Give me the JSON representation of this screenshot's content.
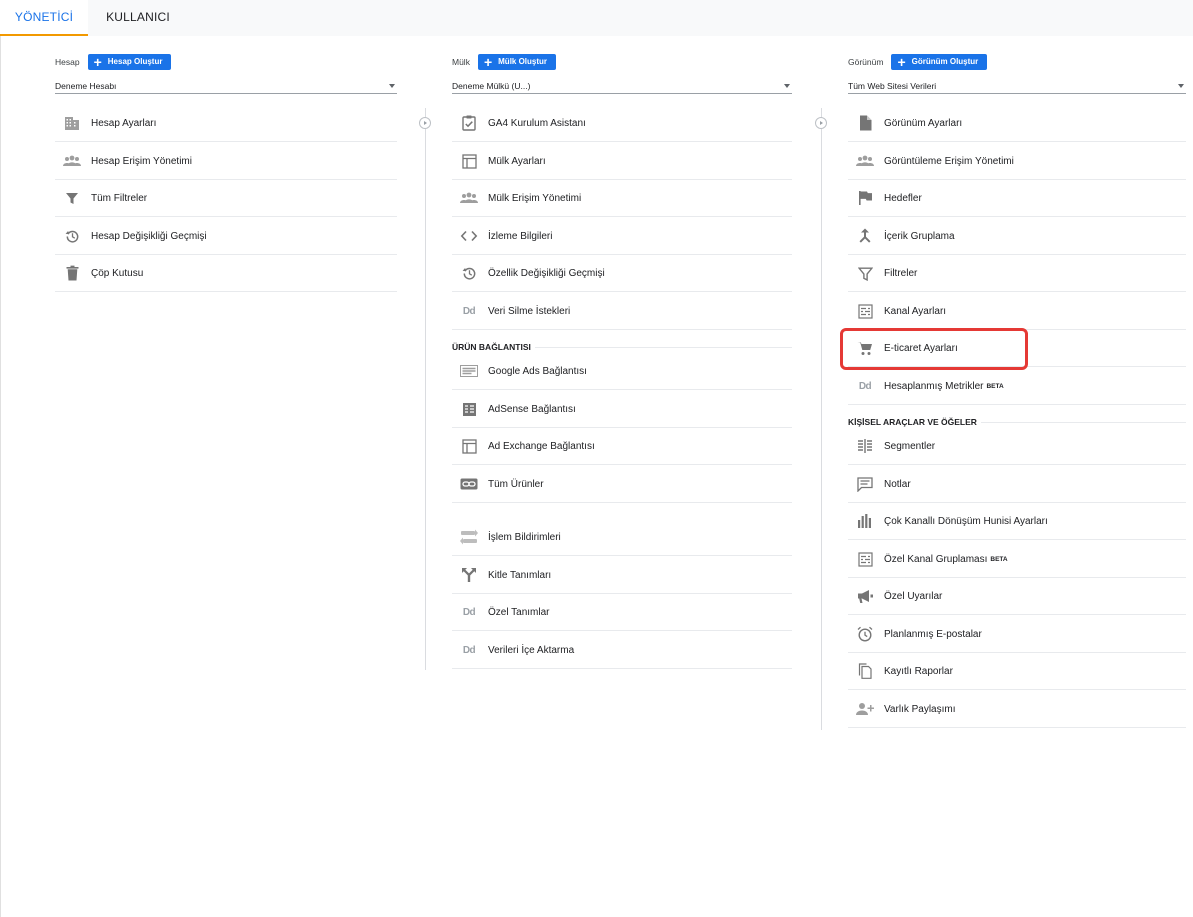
{
  "tabs": [
    {
      "label": "YÖNETİCİ",
      "active": true
    },
    {
      "label": "KULLANICI",
      "active": false
    }
  ],
  "account": {
    "label": "Hesap",
    "create_label": "Hesap Oluştur",
    "selected": "Deneme Hesabı",
    "items": [
      {
        "label": "Hesap Ayarları",
        "icon": "building-icon"
      },
      {
        "label": "Hesap Erişim Yönetimi",
        "icon": "people-icon"
      },
      {
        "label": "Tüm Filtreler",
        "icon": "filter-icon"
      },
      {
        "label": "Hesap Değişikliği Geçmişi",
        "icon": "history-icon"
      },
      {
        "label": "Çöp Kutusu",
        "icon": "trash-icon"
      }
    ]
  },
  "property": {
    "label": "Mülk",
    "create_label": "Mülk Oluştur",
    "selected": "Deneme Mülkü (U...)",
    "items": [
      {
        "label": "GA4 Kurulum Asistanı",
        "icon": "clipboard-check-icon"
      },
      {
        "label": "Mülk Ayarları",
        "icon": "window-icon"
      },
      {
        "label": "Mülk Erişim Yönetimi",
        "icon": "people-icon"
      },
      {
        "label": "İzleme Bilgileri",
        "icon": "code-icon"
      },
      {
        "label": "Özellik Değişikliği Geçmişi",
        "icon": "history-icon"
      },
      {
        "label": "Veri Silme İstekleri",
        "icon": "dd-icon"
      }
    ],
    "section_label": "ÜRÜN BAĞLANTISI",
    "links": [
      {
        "label": "Google Ads Bağlantısı",
        "icon": "ads-icon"
      },
      {
        "label": "AdSense Bağlantısı",
        "icon": "adsense-icon"
      },
      {
        "label": "Ad Exchange Bağlantısı",
        "icon": "window-icon"
      },
      {
        "label": "Tüm Ürünler",
        "icon": "link-icon"
      }
    ],
    "more": [
      {
        "label": "İşlem Bildirimleri",
        "icon": "swap-icon"
      },
      {
        "label": "Kitle Tanımları",
        "icon": "fork-icon"
      },
      {
        "label": "Özel Tanımlar",
        "icon": "dd-icon"
      },
      {
        "label": "Verileri İçe Aktarma",
        "icon": "dd-icon"
      }
    ]
  },
  "view": {
    "label": "Görünüm",
    "create_label": "Görünüm Oluştur",
    "selected": "Tüm Web Sitesi Verileri",
    "items": [
      {
        "label": "Görünüm Ayarları",
        "icon": "document-icon"
      },
      {
        "label": "Görüntüleme Erişim Yönetimi",
        "icon": "people-icon"
      },
      {
        "label": "Hedefler",
        "icon": "flag-icon"
      },
      {
        "label": "İçerik Gruplama",
        "icon": "merge-icon"
      },
      {
        "label": "Filtreler",
        "icon": "filter-icon"
      },
      {
        "label": "Kanal Ayarları",
        "icon": "channel-icon"
      },
      {
        "label": "E-ticaret Ayarları",
        "icon": "cart-icon"
      },
      {
        "label": "Hesaplanmış Metrikler",
        "icon": "dd-icon",
        "badge": "BETA"
      }
    ],
    "section_label": "KİŞİSEL ARAÇLAR VE ÖĞELER",
    "tools": [
      {
        "label": "Segmentler",
        "icon": "segment-icon"
      },
      {
        "label": "Notlar",
        "icon": "comment-icon"
      },
      {
        "label": "Çok Kanallı Dönüşüm Hunisi Ayarları",
        "icon": "bar-chart-icon"
      },
      {
        "label": "Özel Kanal Gruplaması",
        "icon": "channel-icon",
        "badge": "BETA"
      },
      {
        "label": "Özel Uyarılar",
        "icon": "megaphone-icon"
      },
      {
        "label": "Planlanmış E-postalar",
        "icon": "alarm-icon"
      },
      {
        "label": "Kayıtlı Raporlar",
        "icon": "copy-icon"
      },
      {
        "label": "Varlık Paylaşımı",
        "icon": "person-add-icon"
      }
    ]
  },
  "colors": {
    "accent": "#1a73e8",
    "tab_underline": "#f29900",
    "highlight": "#e53935",
    "icon": "#757575"
  }
}
